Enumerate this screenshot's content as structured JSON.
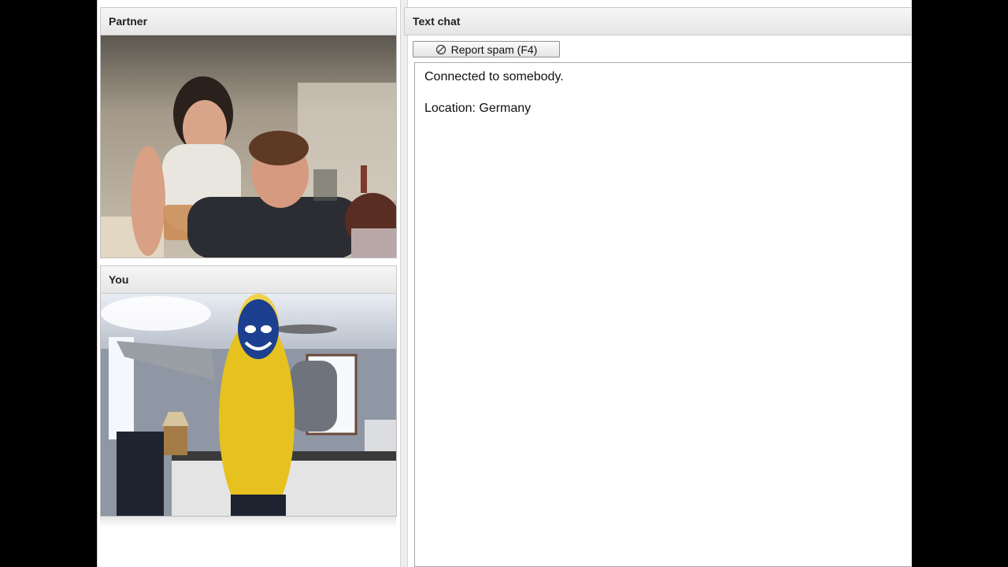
{
  "partner_panel": {
    "title": "Partner"
  },
  "you_panel": {
    "title": "You"
  },
  "text_chat": {
    "title": "Text chat",
    "report_spam_label": "Report spam (F4)",
    "messages": [
      "Connected to somebody.",
      "Location: Germany"
    ]
  },
  "icons": {
    "report": "no-entry-icon"
  }
}
